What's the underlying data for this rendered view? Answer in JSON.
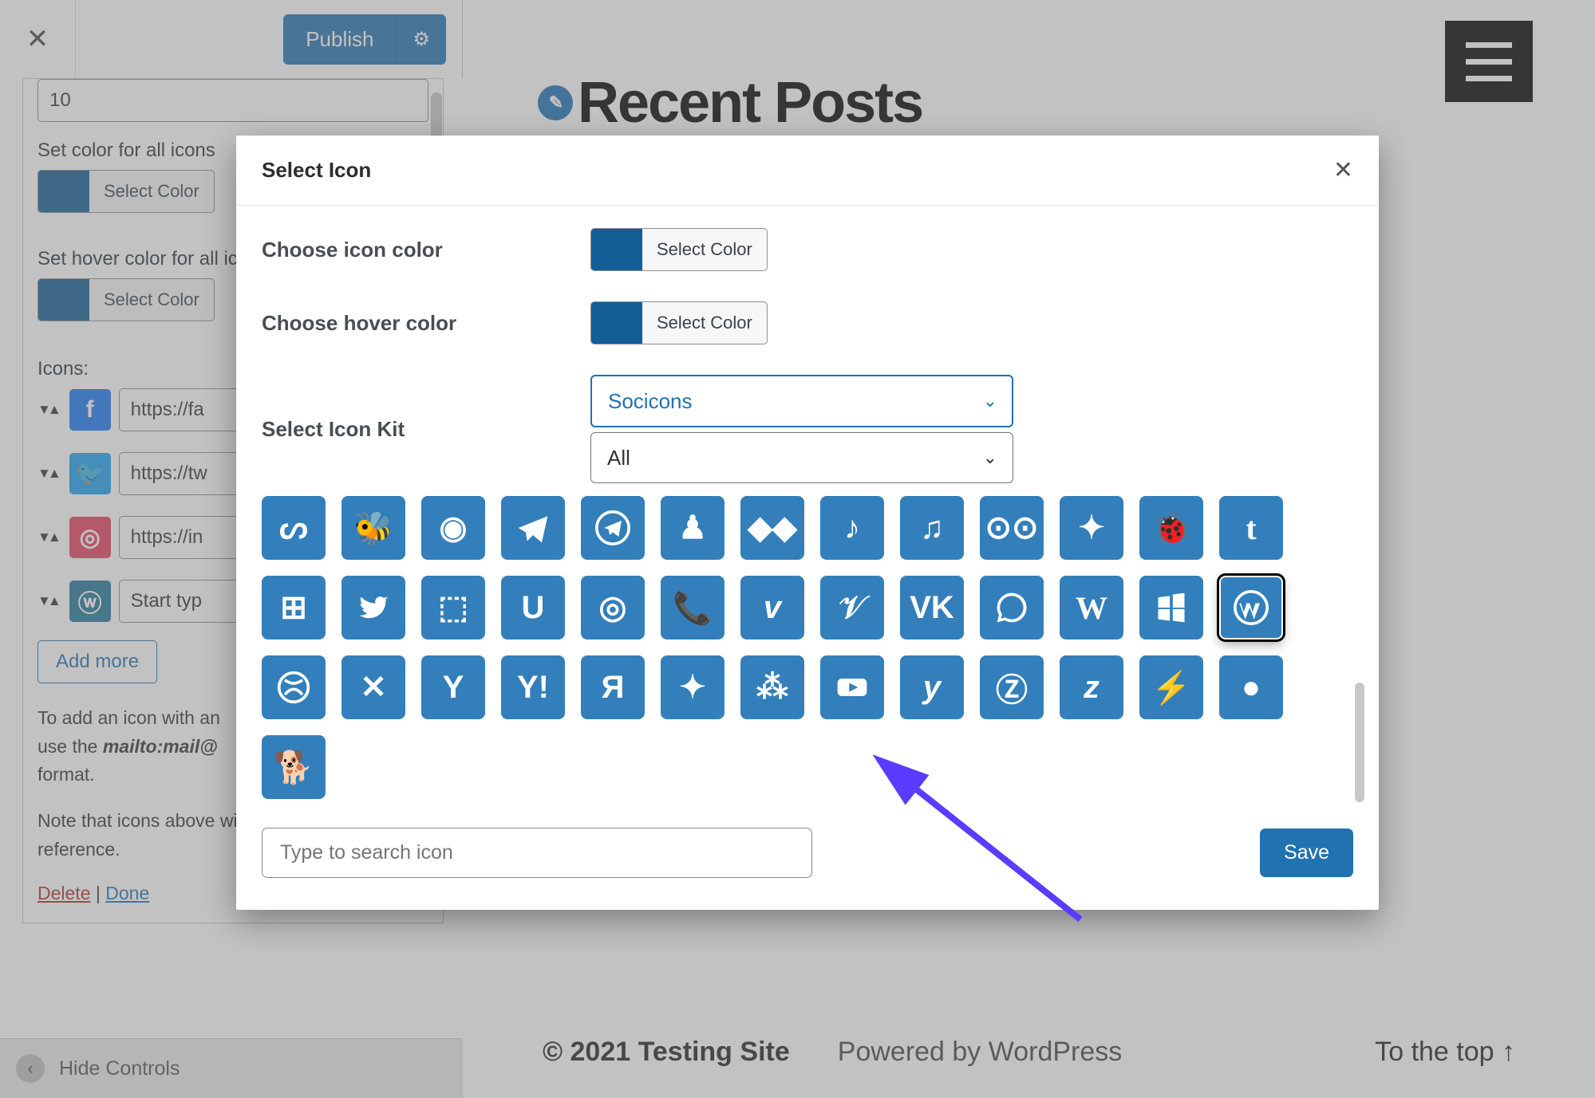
{
  "customizer": {
    "publish_label": "Publish",
    "number_value": "10",
    "color_label": "Set color for all icons",
    "hover_color_label": "Set hover color for all icons",
    "select_color": "Select Color",
    "icons_label": "Icons:",
    "icons": [
      {
        "url": "https://fa",
        "color": "#1877f2",
        "name": "facebook-icon"
      },
      {
        "url": "https://tw",
        "color": "#1da1f2",
        "name": "twitter-icon"
      },
      {
        "url": "https://in",
        "color": "#e4405f",
        "name": "instagram-icon"
      },
      {
        "url": "Start typ",
        "color": "#21759b",
        "name": "wordpress-icon"
      }
    ],
    "add_more": "Add more",
    "help_1_a": "To add an icon with an",
    "help_1_b": "use the ",
    "help_mailto": "mailto:mail@",
    "help_1_c": " format.",
    "help_2": "Note that icons above will look on front-end. reference.",
    "delete": "Delete",
    "done": "Done",
    "hide_controls": "Hide Controls"
  },
  "preview": {
    "title": "Recent Posts",
    "copyright": "© 2021 Testing Site",
    "powered": "Powered by WordPress",
    "to_top": "To the top ↑"
  },
  "modal": {
    "title": "Select Icon",
    "choose_color": "Choose icon color",
    "choose_hover": "Choose hover color",
    "select_kit": "Select Icon Kit",
    "kit_value": "Socicons",
    "kit_filter": "All",
    "select_color": "Select Color",
    "search_placeholder": "Type to search icon",
    "save": "Save",
    "tiles": [
      "stumbleupon",
      "swarm",
      "imessage",
      "telegram",
      "telegram-circle",
      "thumb",
      "tidal",
      "tiktok",
      "tiktok-alt",
      "tripadvisor",
      "sparkle",
      "bug",
      "tumblr",
      "tunein",
      "twitter",
      "unsplash",
      "upwork",
      "target",
      "viber",
      "vimeo",
      "vine",
      "vk",
      "whatsapp",
      "wikipedia",
      "windows",
      "wordpress",
      "xbox",
      "xing",
      "yahoo",
      "yahoo-alt",
      "yandex",
      "sparkle-alt",
      "yelp",
      "youtube",
      "yummly",
      "zazzle",
      "zerply",
      "zillow",
      "zomato",
      "zynga"
    ],
    "selected_tile": "wordpress"
  }
}
